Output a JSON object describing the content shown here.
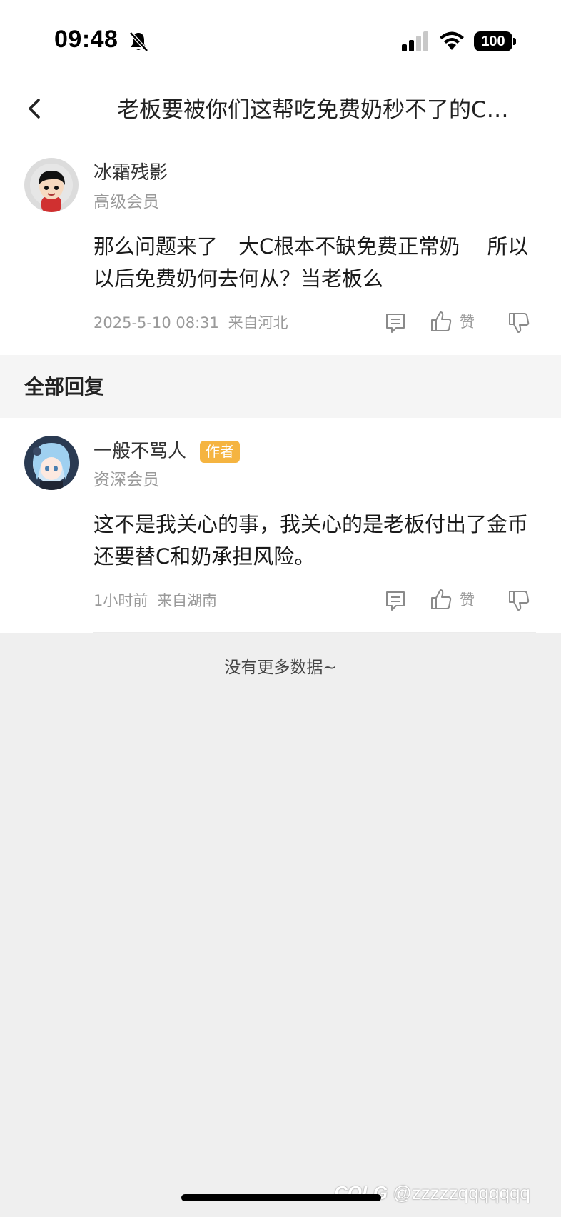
{
  "status_bar": {
    "time": "09:48",
    "battery": "100"
  },
  "nav": {
    "title": "老板要被你们这帮吃免费奶秒不了的C…"
  },
  "main_comment": {
    "username": "冰霜残影",
    "member_level": "高级会员",
    "content": "那么问题来了　大C根本不缺免费正常奶　 所以以后免费奶何去何从？当老板么",
    "timestamp": "2025-5-10 08:31",
    "location": "来自河北",
    "like_label": "赞"
  },
  "section": {
    "title": "全部回复"
  },
  "reply": {
    "username": "一般不骂人",
    "badge": "作者",
    "member_level": "资深会员",
    "content": "这不是我关心的事，我关心的是老板付出了金币还要替C和奶承担风险。",
    "timestamp": "1小时前",
    "location": "来自湖南",
    "like_label": "赞"
  },
  "footer": {
    "no_more_text": "没有更多数据~"
  },
  "watermark": {
    "logo_text": "COLG",
    "handle": "@zzzzzqqqqqqq"
  },
  "colors": {
    "badge": "#f5b440",
    "background": "#efefef",
    "section_bg": "#f5f5f5"
  }
}
